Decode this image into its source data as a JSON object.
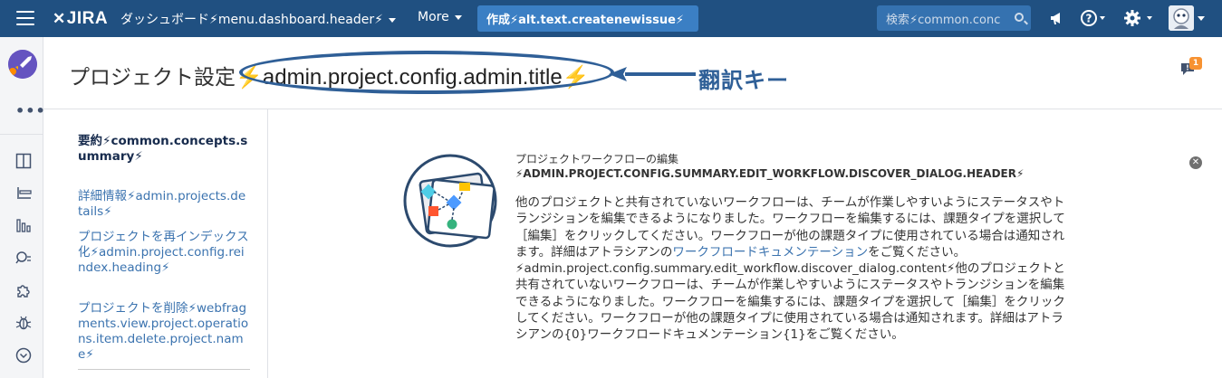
{
  "topbar": {
    "logo": "JIRA",
    "dashboard_label": "ダッシュボード⚡menu.dashboard.header⚡",
    "more_label": "More",
    "create_label": "作成⚡alt.text.createnewissue⚡",
    "search_placeholder": "検索⚡common.conc"
  },
  "header": {
    "title_prefix": "プロジェクト設定",
    "title_key": "⚡admin.project.config.admin.title⚡",
    "annotation": "翻訳キー",
    "feedback_badge": "1"
  },
  "leftnav": {
    "items": [
      {
        "label": "要約⚡common.concepts.summary⚡"
      },
      {
        "label": "詳細情報⚡admin.projects.details⚡"
      },
      {
        "label": "プロジェクトを再インデックス化⚡admin.project.config.reindex.heading⚡"
      },
      {
        "label": "プロジェクトを削除⚡webfragments.view.project.operations.item.delete.project.name⚡"
      }
    ]
  },
  "dialog": {
    "title": "プロジェクトワークフローの編集",
    "key": "⚡ADMIN.PROJECT.CONFIG.SUMMARY.EDIT_WORKFLOW.DISCOVER_DIALOG.HEADER⚡",
    "body_part1": "他のプロジェクトと共有されていないワークフローは、チームが作業しやすいようにステータスやトランジションを編集できるようになりました。ワークフローを編集するには、課題タイプを選択して［編集］をクリックしてください。ワークフローが他の課題タイプに使用されている場合は通知されます。詳細はアトラシアンの",
    "body_link": "ワークフロードキュメンテーション",
    "body_part2": "をご覧ください。⚡admin.project.config.summary.edit_workflow.discover_dialog.content⚡他のプロジェクトと共有されていないワークフローは、チームが作業しやすいようにステータスやトランジションを編集できるようになりました。ワークフローを編集するには、課題タイプを選択して［編集］をクリックしてください。ワークフローが他の課題タイプに使用されている場合は通知されます。詳細はアトラシアンの{0}ワークフロードキュメンテーション{1}をご覧ください。"
  },
  "colors": {
    "topbar": "#205081",
    "create_button": "#3b7fc4",
    "link": "#3b73af",
    "annotation": "#2f5f97"
  }
}
